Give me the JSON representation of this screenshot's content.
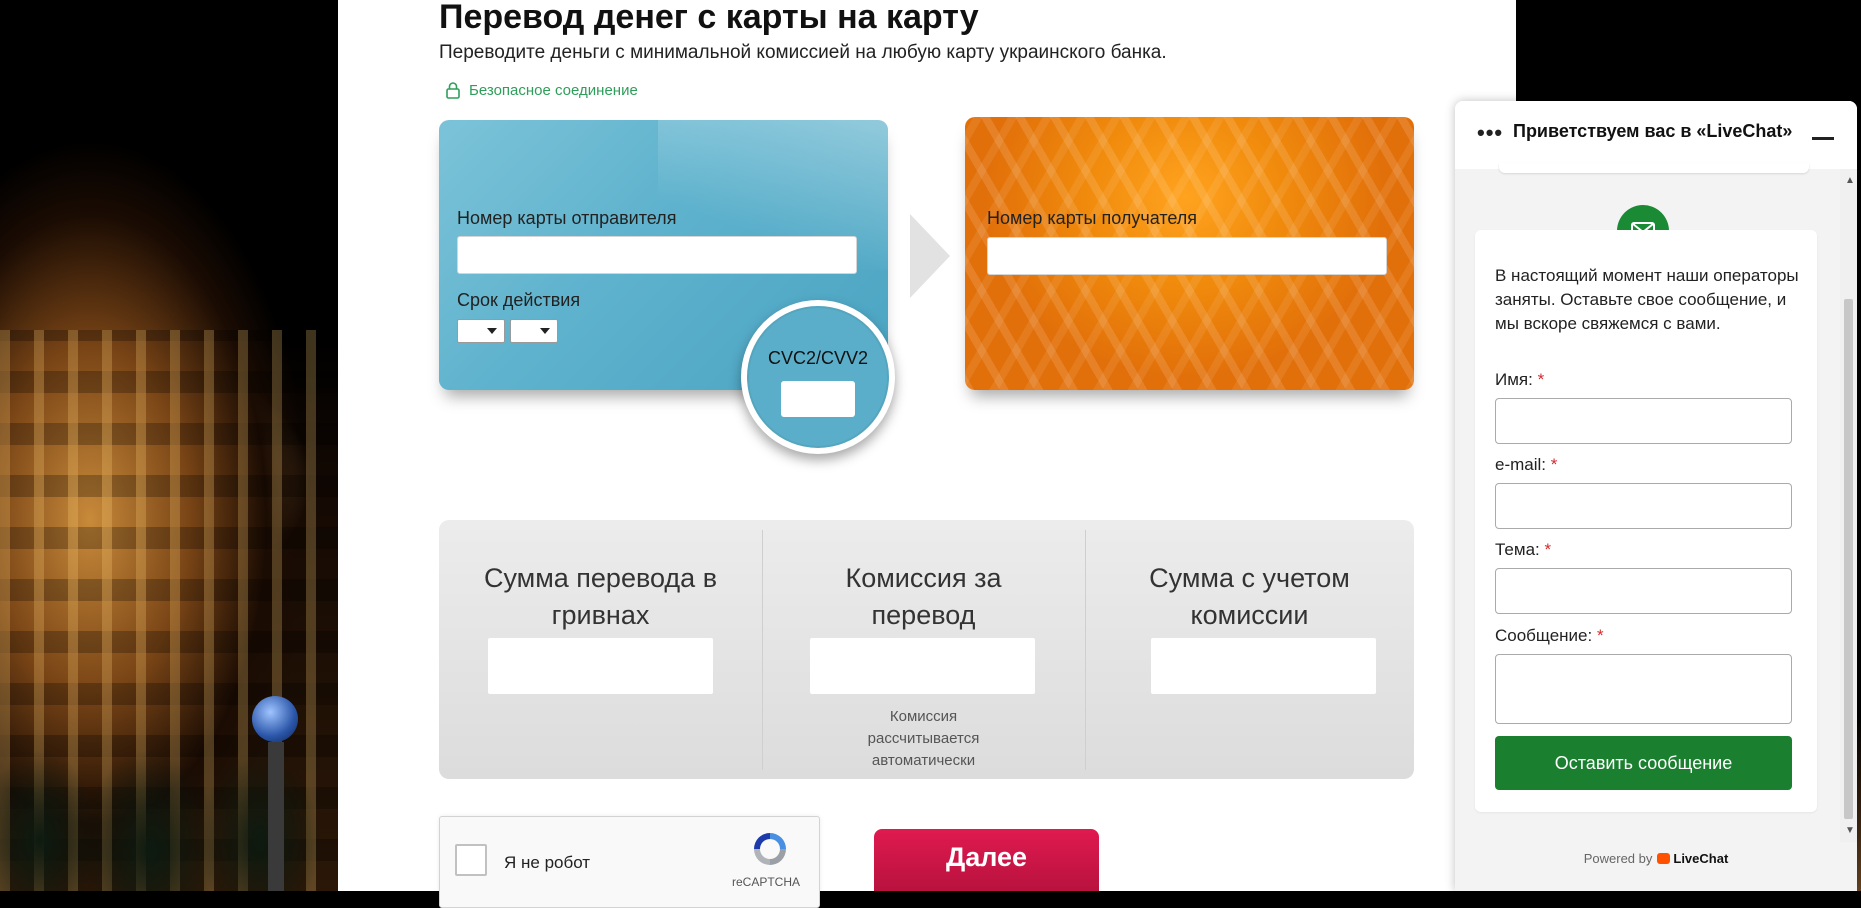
{
  "page": {
    "title": "Перевод денег с карты на карту",
    "subtitle": "Переводите деньги с минимальной комиссией на любую карту украинского банка.",
    "secure_label": "Безопасное соединение"
  },
  "sender_card": {
    "number_label": "Номер карты отправителя",
    "expiry_label": "Срок действия",
    "cvc_label": "CVC2/CVV2"
  },
  "receiver_card": {
    "number_label": "Номер карты получателя"
  },
  "sums": {
    "amount_title": "Сумма перевода в гривнах",
    "commission_title": "Комиссия за перевод",
    "commission_note": "Комиссия рассчитывается автоматически",
    "total_title": "Сумма с учетом комиссии"
  },
  "recaptcha": {
    "label": "Я не робот",
    "brand": "reCAPTCHA"
  },
  "next_button": "Далее",
  "chat": {
    "title": "Приветствуем вас в «LiveChat»",
    "message": "В настоящий момент наши операторы заняты. Оставьте свое сообщение, и мы вскоре свяжемся с вами.",
    "name_label": "Имя:",
    "email_label": "e-mail:",
    "subject_label": "Тема:",
    "message_label": "Сообщение:",
    "required_mark": "*",
    "submit_label": "Оставить сообщение",
    "powered_by": "Powered by",
    "brand": "LiveChat"
  },
  "colors": {
    "sender_card": "#5eb2cd",
    "receiver_card": "#f08a0c",
    "next_button": "#c8164a",
    "chat_accent": "#1a7f2e",
    "secure_text": "#2e9e5a"
  }
}
